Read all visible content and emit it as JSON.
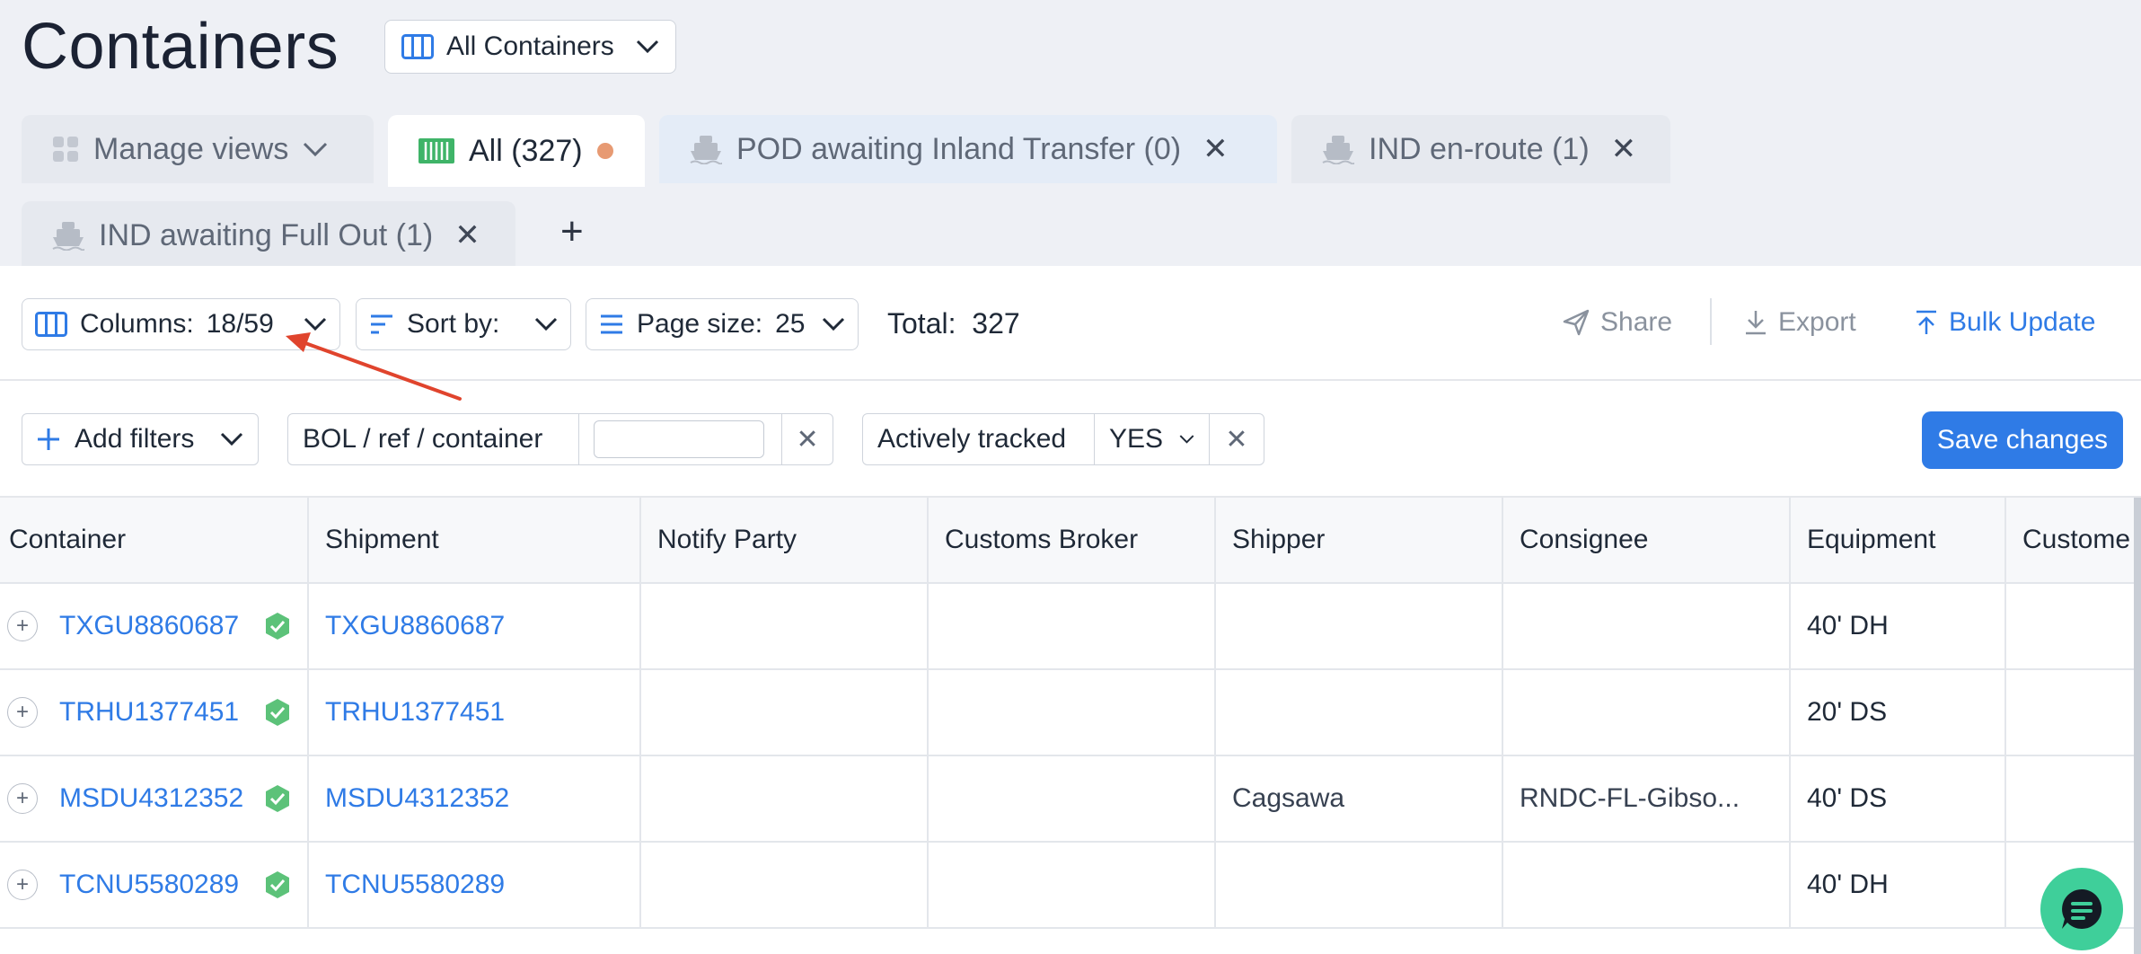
{
  "header": {
    "title": "Containers",
    "view_selector": "All Containers"
  },
  "tabs": [
    {
      "label": "Manage views"
    },
    {
      "label": "All (327)"
    },
    {
      "label": "POD awaiting Inland Transfer (0)"
    },
    {
      "label": "IND en-route (1)"
    },
    {
      "label": "IND awaiting Full Out (1)"
    }
  ],
  "toolbar": {
    "columns_label": "Columns:",
    "columns_value": "18/59",
    "sort_label": "Sort by:",
    "page_size_label": "Page size:",
    "page_size_value": "25",
    "total_label": "Total:",
    "total_value": "327",
    "share": "Share",
    "export": "Export",
    "bulk_update": "Bulk Update"
  },
  "filters": {
    "add_filters": "Add filters",
    "ref_label": "BOL / ref / container",
    "ref_value": "",
    "tracked_label": "Actively tracked",
    "tracked_value": "YES",
    "save": "Save changes"
  },
  "table": {
    "columns": [
      "Container",
      "Shipment",
      "Notify Party",
      "Customs Broker",
      "Shipper",
      "Consignee",
      "Equipment",
      "Custome"
    ],
    "rows": [
      {
        "container": "TXGU8860687",
        "shipment": "TXGU8860687",
        "notify": "",
        "broker": "",
        "shipper": "",
        "consignee": "",
        "equipment": "40' DH"
      },
      {
        "container": "TRHU1377451",
        "shipment": "TRHU1377451",
        "notify": "",
        "broker": "",
        "shipper": "",
        "consignee": "",
        "equipment": "20' DS"
      },
      {
        "container": "MSDU4312352",
        "shipment": "MSDU4312352",
        "notify": "",
        "broker": "",
        "shipper": "Cagsawa",
        "consignee": "RNDC-FL-Gibso...",
        "equipment": "40' DS"
      },
      {
        "container": "TCNU5580289",
        "shipment": "TCNU5580289",
        "notify": "",
        "broker": "",
        "shipper": "",
        "consignee": "",
        "equipment": "40' DH"
      }
    ]
  },
  "colors": {
    "accent": "#2f7be6",
    "tracked_badge": "#5cc279",
    "unsaved_dot": "#e79a73",
    "annotation_arrow": "#e0442d",
    "chat": "#3fcf9a"
  },
  "icons": [
    "columns-icon",
    "chevron-down-icon",
    "grid-icon",
    "container-icon",
    "ship-icon",
    "close-icon",
    "plus-icon",
    "sort-icon",
    "list-icon",
    "share-icon",
    "download-icon",
    "upload-icon",
    "shield-check-icon",
    "chat-icon"
  ]
}
